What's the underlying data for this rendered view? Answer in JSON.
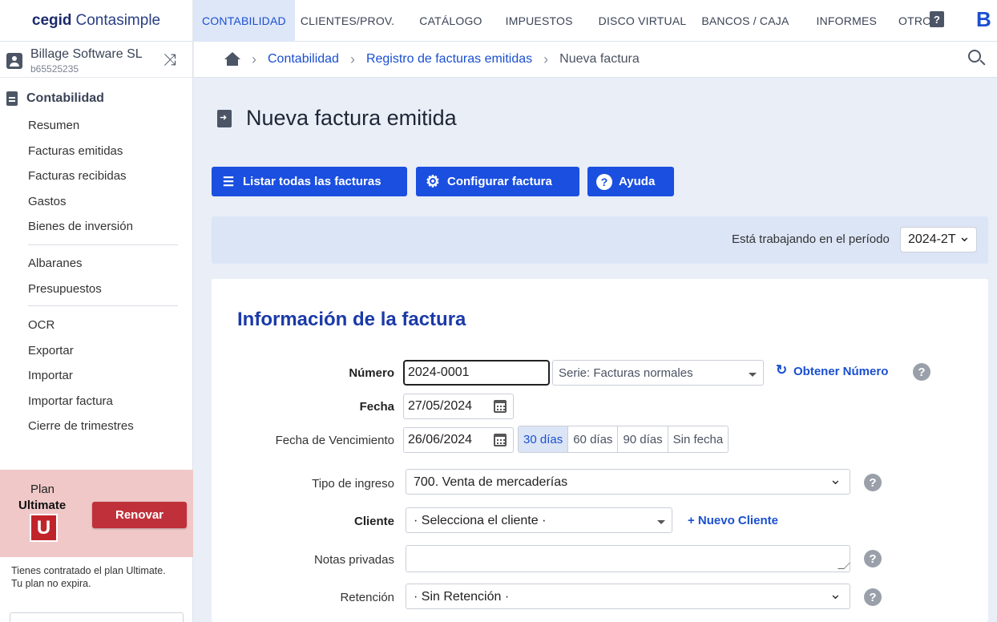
{
  "brand": {
    "part1": "cegid",
    "part2": "Contasimple"
  },
  "topnav": {
    "items": [
      "CONTABILIDAD",
      "CLIENTES/PROV.",
      "CATÁLOGO",
      "IMPUESTOS",
      "DISCO VIRTUAL",
      "BANCOS / CAJA",
      "INFORMES",
      "OTROS"
    ],
    "help": "?",
    "logo": "B"
  },
  "sidebar": {
    "account_name": "Billage Software SL",
    "account_id": "b65525235",
    "section": "Contabilidad",
    "group1": [
      "Resumen",
      "Facturas emitidas",
      "Facturas recibidas",
      "Gastos",
      "Bienes de inversión"
    ],
    "group2": [
      "Albaranes",
      "Presupuestos"
    ],
    "group3": [
      "OCR",
      "Exportar",
      "Importar",
      "Importar factura",
      "Cierre de trimestres"
    ],
    "plan_label": "Plan",
    "plan_name": "Ultimate",
    "plan_badge": "U",
    "renew": "Renovar",
    "note_line1": "Tienes contratado el plan Ultimate.",
    "note_line2": "Tu plan no expira."
  },
  "breadcrumb": {
    "items": [
      "Contabilidad",
      "Registro de facturas emitidas"
    ],
    "current": "Nueva factura"
  },
  "page": {
    "title": "Nueva factura emitida",
    "buttons": {
      "list": "Listar todas las facturas",
      "config": "Configurar factura",
      "help": "Ayuda"
    },
    "period_label": "Está trabajando en el período",
    "period_value": "2024-2T"
  },
  "form": {
    "title": "Información de la factura",
    "numero_label": "Número",
    "numero_value": "2024-0001",
    "serie_value": "Serie: Facturas normales",
    "obtener": "Obtener Número",
    "fecha_label": "Fecha",
    "fecha_value": "27/05/2024",
    "venc_label": "Fecha de Vencimiento",
    "venc_value": "26/06/2024",
    "days": [
      "30 días",
      "60 días",
      "90 días",
      "Sin fecha"
    ],
    "tipo_label": "Tipo de ingreso",
    "tipo_value": "700. Venta de mercaderías",
    "cliente_label": "Cliente",
    "cliente_value": "· Selecciona el cliente ·",
    "nuevo_cliente": "+ Nuevo Cliente",
    "notas_label": "Notas privadas",
    "retencion_label": "Retención",
    "retencion_value": "· Sin Retención ·",
    "help_glyph": "?"
  },
  "colors": {
    "accent": "#1a4fe0",
    "link": "#1a4fd0",
    "plan_bg": "#f0c8c8",
    "renew": "#c0303a"
  }
}
